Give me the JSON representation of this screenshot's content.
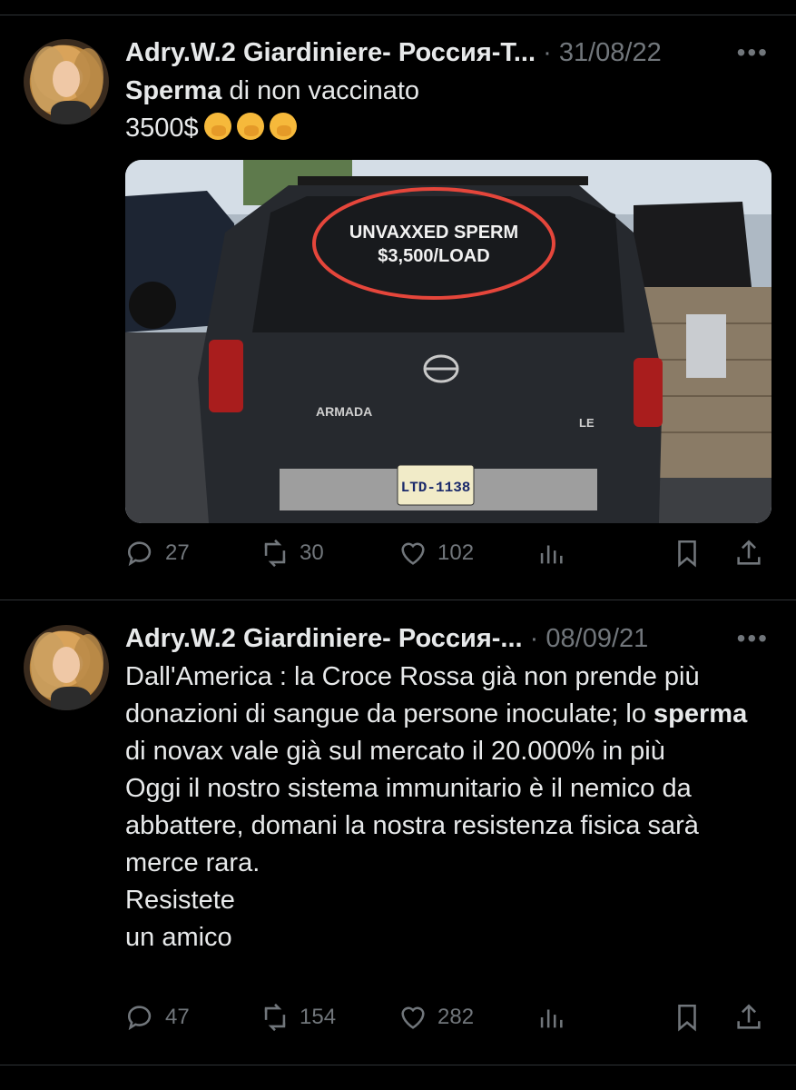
{
  "tweets": [
    {
      "author": "Adry.W.2 Giardiniere- Россия-Т...",
      "dot": "·",
      "date": "31/08/22",
      "more": "•••",
      "text_bold_1": "Sperma",
      "text_rest_1": " di non vaccinato",
      "text_line_2": "3500$",
      "image": {
        "sign_line1": "UNVAXXED SPERM",
        "sign_line2": "$3,500/LOAD",
        "badge": "ARMADA",
        "trim": "LE",
        "plate": "LTD-1138"
      },
      "replies": "27",
      "retweets": "30",
      "likes": "102"
    },
    {
      "author": "Adry.W.2 Giardiniere- Россия-...",
      "dot": "·",
      "date": "08/09/21",
      "more": "•••",
      "p1": "Dall'America : la Croce Rossa già non prende più donazioni di sangue da persone inoculate; lo ",
      "p1_bold": "sperma",
      "p1_rest": " di novax vale già sul mercato il 20.000% in più",
      "p2": "Oggi il nostro sistema immunitario è il nemico da abbattere, domani la nostra resistenza fisica sarà merce rara.",
      "p3": "Resistete",
      "p4": "un amico",
      "replies": "47",
      "retweets": "154",
      "likes": "282"
    }
  ]
}
